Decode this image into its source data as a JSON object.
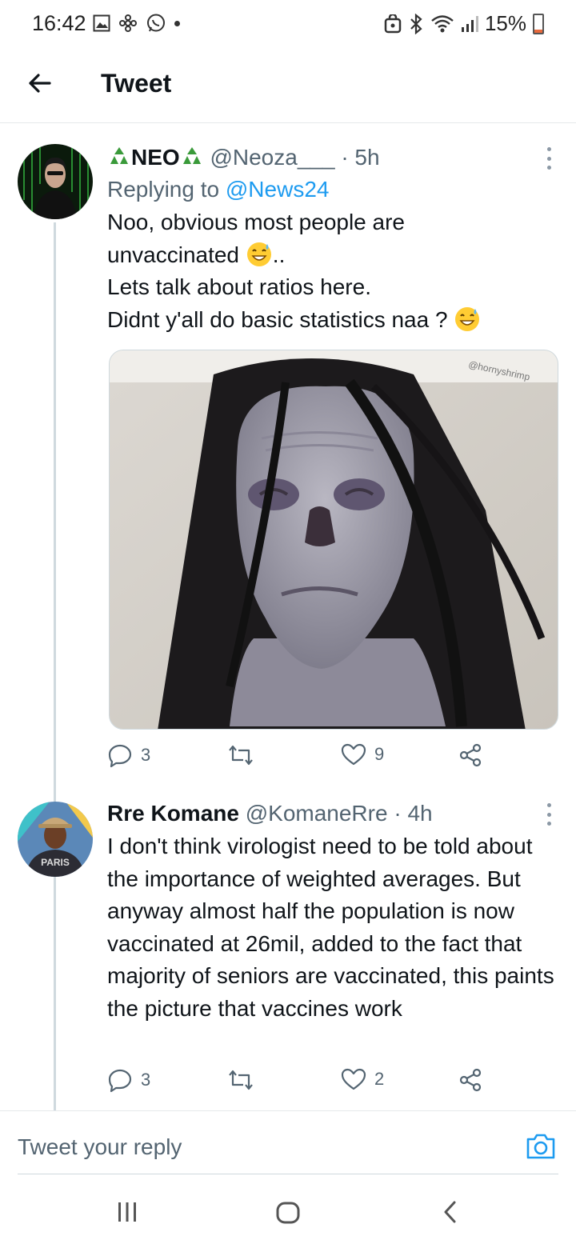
{
  "status_bar": {
    "time": "16:42",
    "battery_percent": "15%",
    "battery_level": 0.15,
    "left_icons": [
      "gallery-icon",
      "pinwheel-icon",
      "whatsapp-icon",
      "notification-dot"
    ],
    "right_icons": [
      "alarm-icon",
      "bluetooth-icon",
      "wifi-icon",
      "signal-icon",
      "battery-icon"
    ]
  },
  "header": {
    "title": "Tweet",
    "back_icon": "arrow-left-icon"
  },
  "tweets": [
    {
      "display_name": "NEO",
      "name_decoration": "recycle-icon",
      "handle": "@Neoza___",
      "time": "· 5h",
      "replying_prefix": "Replying to",
      "replying_to": "@News24",
      "text_line1": "Noo, obvious most people are",
      "text_line2": "unvaccinated",
      "text_line2_suffix": "..",
      "text_line3": "Lets talk about ratios here.",
      "text_line4": "Didnt y'all do basic statistics naa ?",
      "emoji": "grinning-sweat-emoji",
      "media_watermark": "@hornyshrimp",
      "media_description": "zombie-mask-photo",
      "replies": "3",
      "retweets": "",
      "likes": "9"
    },
    {
      "display_name": "Rre Komane",
      "handle": "@KomaneRre",
      "time": "· 4h",
      "text": "I don't think virologist need to be told about the importance of weighted averages. But anyway almost half the population is now vaccinated at 26mil, added to the fact that majority of seniors are vaccinated, this paints the picture that vaccines work",
      "avatar_shirt_text": "PARIS",
      "replies": "3",
      "retweets": "",
      "likes": "2"
    }
  ],
  "reply_bar": {
    "placeholder": "Tweet your reply",
    "camera_icon": "camera-icon"
  },
  "nav_bar": {
    "buttons": [
      "recent-apps-icon",
      "home-icon",
      "back-icon"
    ]
  },
  "colors": {
    "accent": "#1d9bf0",
    "text_primary": "#0f1419",
    "text_secondary": "#536471",
    "divider": "#e6e9eb",
    "battery_low": "#e8693c"
  }
}
